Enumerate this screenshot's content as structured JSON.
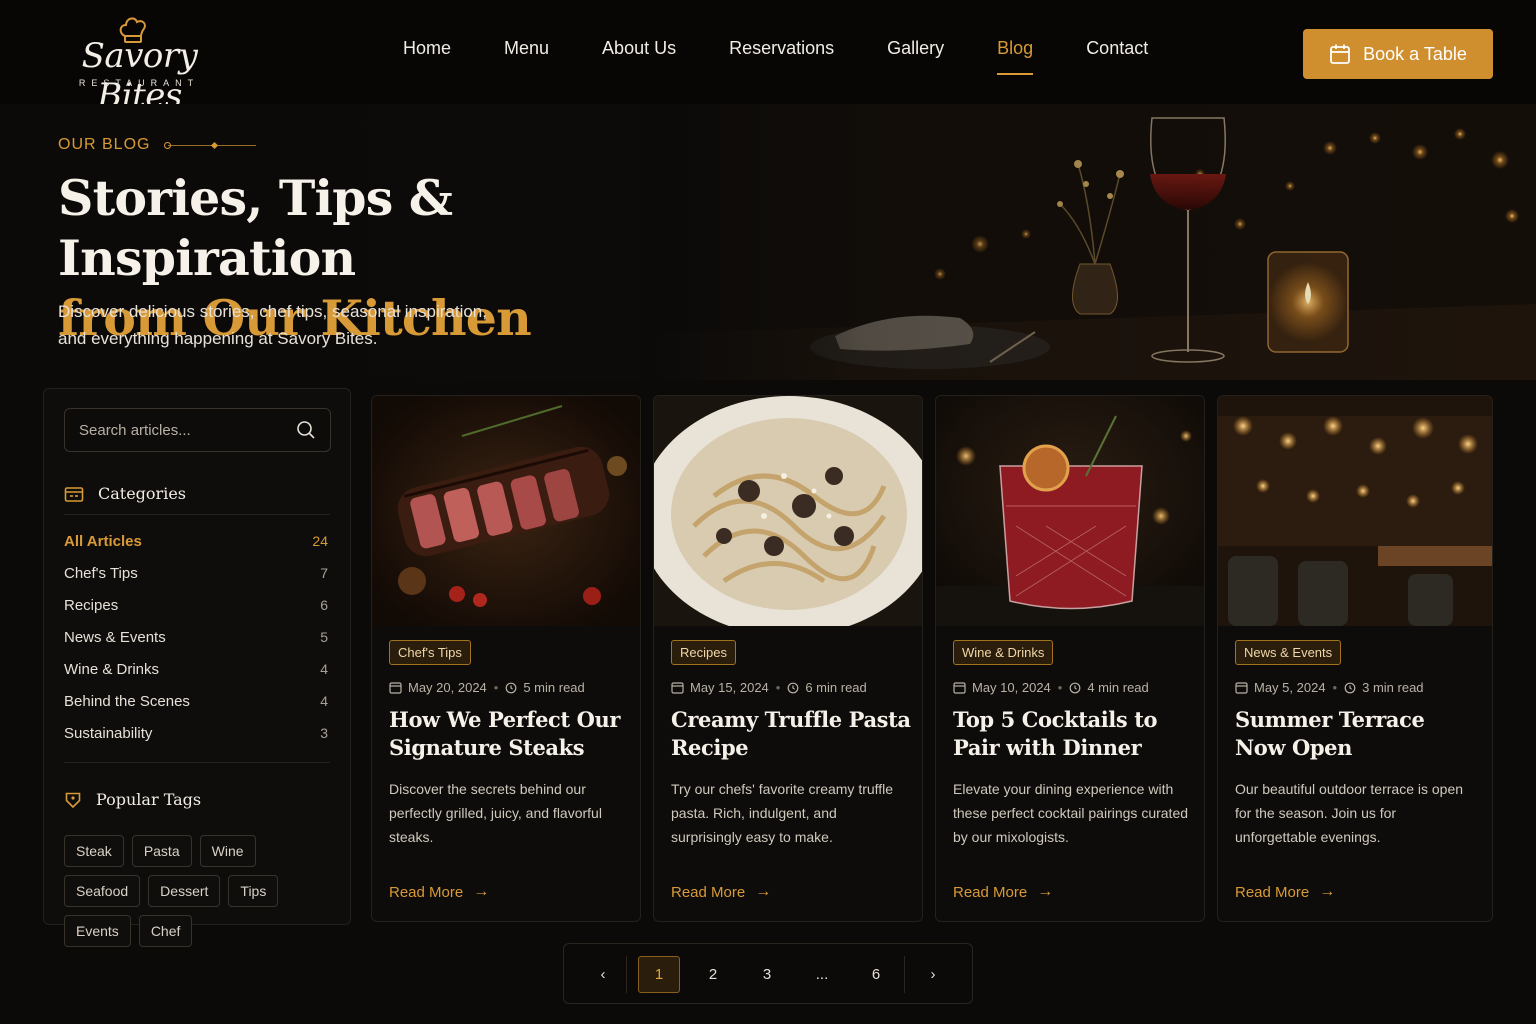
{
  "brand": {
    "name": "Savory Bites",
    "subtitle": "RESTAURANT"
  },
  "nav": {
    "links": [
      {
        "label": "Home"
      },
      {
        "label": "Menu"
      },
      {
        "label": "About Us"
      },
      {
        "label": "Reservations"
      },
      {
        "label": "Gallery"
      },
      {
        "label": "Blog",
        "active": true
      },
      {
        "label": "Contact"
      }
    ],
    "cta_label": "Book a Table"
  },
  "hero": {
    "eyebrow": "OUR BLOG",
    "title_line1": "Stories, Tips & Inspiration",
    "title_line2": "from Our Kitchen",
    "description": "Discover delicious stories, chef tips, seasonal inspiration, and everything happening at Savory Bites."
  },
  "sidebar": {
    "search_placeholder": "Search articles...",
    "categories_heading": "Categories",
    "categories": [
      {
        "label": "All Articles",
        "count": "24",
        "active": true
      },
      {
        "label": "Chef's Tips",
        "count": "7"
      },
      {
        "label": "Recipes",
        "count": "6"
      },
      {
        "label": "News & Events",
        "count": "5"
      },
      {
        "label": "Wine & Drinks",
        "count": "4"
      },
      {
        "label": "Behind the Scenes",
        "count": "4"
      },
      {
        "label": "Sustainability",
        "count": "3"
      }
    ],
    "tags_heading": "Popular Tags",
    "tags": [
      "Steak",
      "Pasta",
      "Wine",
      "Seafood",
      "Dessert",
      "Tips",
      "Events",
      "Chef"
    ]
  },
  "articles": [
    {
      "category": "Chef's Tips",
      "date": "May 20, 2024",
      "read_time": "5 min read",
      "title": "How We Perfect Our Signature Steaks",
      "excerpt": "Discover the secrets behind our perfectly grilled, juicy, and flavorful steaks.",
      "link_label": "Read More"
    },
    {
      "category": "Recipes",
      "date": "May 15, 2024",
      "read_time": "6 min read",
      "title": "Creamy Truffle Pasta Recipe",
      "excerpt": "Try our chefs' favorite creamy truffle pasta. Rich, indulgent, and surprisingly easy to make.",
      "link_label": "Read More"
    },
    {
      "category": "Wine & Drinks",
      "date": "May 10, 2024",
      "read_time": "4 min read",
      "title": "Top 5 Cocktails to Pair with Dinner",
      "excerpt": "Elevate your dining experience with these perfect cocktail pairings curated by our mixologists.",
      "link_label": "Read More"
    },
    {
      "category": "News & Events",
      "date": "May 5, 2024",
      "read_time": "3 min read",
      "title": "Summer Terrace Now Open",
      "excerpt": "Our beautiful outdoor terrace is open for the season. Join us for unforgettable evenings.",
      "link_label": "Read More"
    }
  ],
  "pagination": {
    "prev": "‹",
    "pages": [
      "1",
      "2",
      "3",
      "...",
      "6"
    ],
    "current": "1",
    "next": "›"
  },
  "colors": {
    "accent": "#d89a36",
    "background": "#0b0a09",
    "button": "#cf8f2f"
  }
}
